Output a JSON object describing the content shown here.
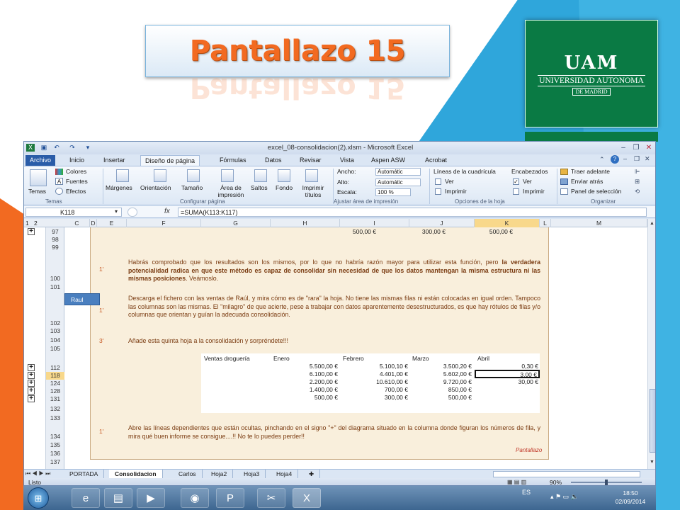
{
  "slide": {
    "title": "Pantallazo 15",
    "logo_text": "UAM",
    "logo_name": "UNIVERSIDAD AUTONOMA",
    "logo_sub": "DE MADRID"
  },
  "window": {
    "title": "excel_08-consolidacion(2).xlsm - Microsoft Excel"
  },
  "ribbon": {
    "tabs": [
      "Archivo",
      "Inicio",
      "Insertar",
      "Diseño de página",
      "Fórmulas",
      "Datos",
      "Revisar",
      "Vista",
      "Aspen ASW",
      "Acrobat"
    ],
    "themes": {
      "temas": "Temas",
      "colores": "Colores",
      "fuentes": "Fuentes",
      "efectos": "Efectos"
    },
    "page_setup": {
      "margenes": "Márgenes",
      "orientacion": "Orientación",
      "tamano": "Tamaño",
      "area": "Área de impresión",
      "saltos": "Saltos",
      "fondo": "Fondo",
      "imprimir_titulos": "Imprimir títulos"
    },
    "scale": {
      "ancho_label": "Ancho:",
      "ancho_value": "Automátic",
      "alto_label": "Alto:",
      "alto_value": "Automátic",
      "escala_label": "Escala:",
      "escala_value": "100 %"
    },
    "sheet_options": {
      "lineas": "Líneas de la cuadrícula",
      "encabezados": "Encabezados",
      "ver1": "Ver",
      "ver2": "Ver",
      "imprimir1": "Imprimir",
      "imprimir2": "Imprimir"
    },
    "arrange": {
      "traer": "Traer adelante",
      "enviar": "Enviar atrás",
      "panel": "Panel de selección"
    },
    "groups": {
      "temas": "Temas",
      "configurar": "Configurar página",
      "ajustar": "Ajustar área de impresión",
      "opciones": "Opciones de la hoja",
      "organizar": "Organizar"
    }
  },
  "formula_bar": {
    "name_box": "K118",
    "fx": "fx",
    "formula": "=SUMA(K113:K117)"
  },
  "columns": [
    "C",
    "D",
    "E",
    "F",
    "G",
    "H",
    "I",
    "J",
    "K",
    "L",
    "M"
  ],
  "outline_levels": [
    "1",
    "2"
  ],
  "rows": [
    "97",
    "98",
    "99",
    "100",
    "101",
    "102",
    "103",
    "104",
    "105",
    "112",
    "118",
    "124",
    "128",
    "131",
    "132",
    "133",
    "134",
    "135",
    "136",
    "137"
  ],
  "sheet": {
    "row97": {
      "h": "500,00 €",
      "i": "300,00 €",
      "j": "500,00 €"
    },
    "step1": {
      "time": "1'",
      "text_a": "Habrás comprobado que los resultados son los mismos, por lo que no habría razón mayor para utilizar esta función, pero ",
      "text_bold": "la verdadera potencialidad radica en que este método es capaz de consolidar sin necesidad de que los datos mantengan la misma estructura ni las mismas posiciones",
      "text_b": ". Veámoslo."
    },
    "raul_label": "Raul",
    "step2": {
      "time": "1'",
      "text": "Descarga el fichero con las ventas de Raúl, y mira cómo es de \"rara\" la hoja. No tiene las mismas filas ni están colocadas en igual orden. Tampoco las columnas son las mismas. El \"milagro\" de que acierte, pese a trabajar con datos aparentemente desestructurados, es que hay rótulos de filas y/o columnas que orientan y guían la adecuada consolidación."
    },
    "step3": {
      "time": "3'",
      "text": "Añade esta quinta hoja a la consolidación y sorpréndete!!!"
    },
    "table": {
      "headers": [
        "Ventas droguería",
        "Enero",
        "Febrero",
        "Marzo",
        "Abril"
      ],
      "rows": [
        [
          "5.500,00 €",
          "5.100,10 €",
          "3.500,20 €",
          "0,30 €"
        ],
        [
          "6.100,00 €",
          "4.401,00 €",
          "5.602,00 €",
          "3,00 €"
        ],
        [
          "2.200,00 €",
          "10.610,00 €",
          "9.720,00 €",
          "30,00 €"
        ],
        [
          "1.400,00 €",
          "700,00 €",
          "850,00 €",
          ""
        ],
        [
          "500,00 €",
          "300,00 €",
          "500,00 €",
          ""
        ]
      ]
    },
    "step4": {
      "time": "1'",
      "text": "Abre las líneas dependientes que están ocultas, pinchando en el signo \"+\" del diagrama situado en la columna donde figuran los números de fila, y mira qué buen informe se consigue....!! No te lo puedes perder!!"
    },
    "footer": "Pantallazo"
  },
  "sheet_tabs": [
    "PORTADA",
    "Consolidacion",
    "Carlos",
    "Hoja2",
    "Hoja3",
    "Hoja4"
  ],
  "status": {
    "left": "Listo",
    "zoom": "90%"
  },
  "taskbar": {
    "lang": "ES",
    "time": "18:50",
    "date": "02/09/2014"
  },
  "colors": {
    "accent": "#f26a21",
    "excel_file_tab": "#2a5ca8",
    "page_fill": "#f9efdc",
    "text_brown": "#7a3b11"
  }
}
